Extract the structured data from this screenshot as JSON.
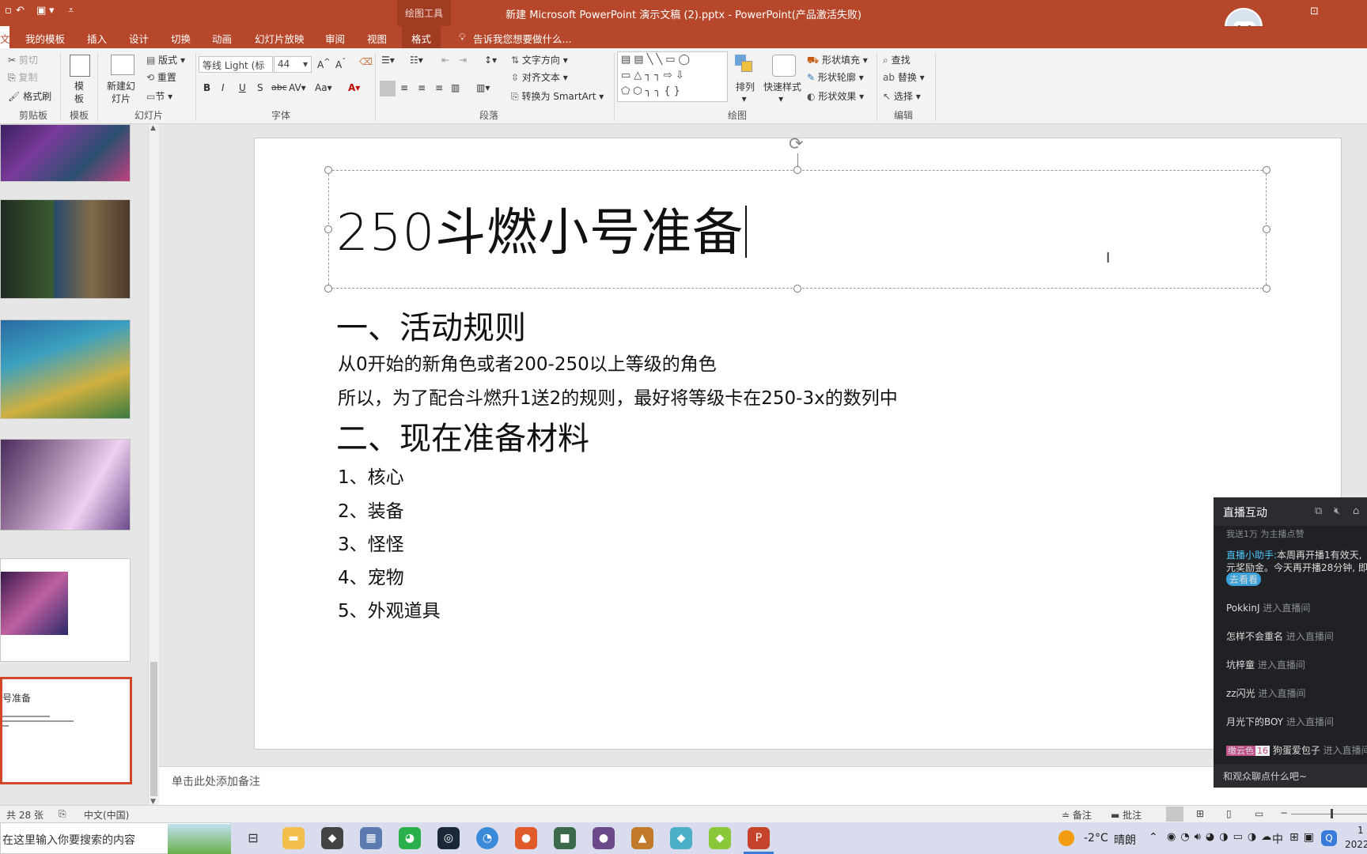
{
  "app": {
    "window_title": "新建 Microsoft PowerPoint 演示文稿 (2).pptx - PowerPoint(产品激活失败)",
    "contextual_group": "绘图工具"
  },
  "tabs": {
    "file": "文件",
    "items": [
      "我的模板",
      "插入",
      "设计",
      "切换",
      "动画",
      "幻灯片放映",
      "审阅",
      "视图"
    ],
    "format": "格式",
    "tell_me": "告诉我您想要做什么..."
  },
  "ribbon": {
    "clipboard": {
      "cut": "剪切",
      "copy": "复制",
      "format_painter": "格式刷",
      "label": "剪贴板"
    },
    "template": {
      "button": "模板",
      "label": "模板"
    },
    "slides": {
      "new_slide": "新建幻灯片",
      "layout": "版式",
      "reset": "重置",
      "section": "节",
      "label": "幻灯片"
    },
    "font": {
      "font_name": "等线 Light (标",
      "font_size": "44",
      "label": "字体"
    },
    "paragraph": {
      "text_direction": "文字方向",
      "align_text": "对齐文本",
      "smartart": "转换为 SmartArt",
      "label": "段落"
    },
    "drawing": {
      "arrange": "排列",
      "quick_styles": "快速样式",
      "shape_fill": "形状填充",
      "shape_outline": "形状轮廓",
      "shape_effects": "形状效果",
      "label": "绘图"
    },
    "editing": {
      "find": "查找",
      "replace": "替换",
      "select": "选择",
      "label": "编辑"
    }
  },
  "thumbnails": {
    "last_title": "号准备",
    "colors": [
      "#5a3a7a",
      "#3e5a3a",
      "#3a5f8a",
      "#6a4a6a",
      "#ffffff",
      "#ffffff"
    ]
  },
  "slide": {
    "title": "250斗燃小号准备",
    "h1_a": "一、活动规则",
    "p1": "从0开始的新角色或者200-250以上等级的角色",
    "p2": "所以，为了配合斗燃升1送2的规则，最好将等级卡在250-3x的数列中",
    "h1_b": "二、现在准备材料",
    "items": [
      "1、核心",
      "2、装备",
      "3、怪怪",
      "4、宠物",
      "5、外观道具"
    ]
  },
  "notes": {
    "placeholder": "单击此处添加备注"
  },
  "status": {
    "slide_count": "共 28 张",
    "language": "中文(中国)",
    "notes": "备注",
    "comments": "批注"
  },
  "taskbar": {
    "search_placeholder": "在这里输入你要搜索的内容",
    "temperature": "-2°C",
    "weather": "晴朗",
    "ime": "中",
    "time_partial": "1",
    "date_partial": "2022"
  },
  "live_panel": {
    "title": "直播互动",
    "top_msg": "我送1万 为主播点赞",
    "helper_name": "直播小助手:",
    "helper_text_1": "本周再开播1有效天,",
    "helper_text_2": "元奖励金。今天再开播28分钟, 即",
    "helper_link": "去看看",
    "enter_suffix": "进入直播间",
    "viewers": [
      "PokkinJ",
      "怎样不会重名",
      "坑梓童",
      "zz闪光",
      "月光下的BOY"
    ],
    "badge_name": "缴云色",
    "badge_level": "16",
    "last_viewer": "狗蛋爱包子",
    "input_placeholder": "和观众聊点什么吧~"
  },
  "colors": {
    "accent": "#b7472a",
    "accent_dark": "#a13c22",
    "selected_thumb": "#d24726"
  }
}
